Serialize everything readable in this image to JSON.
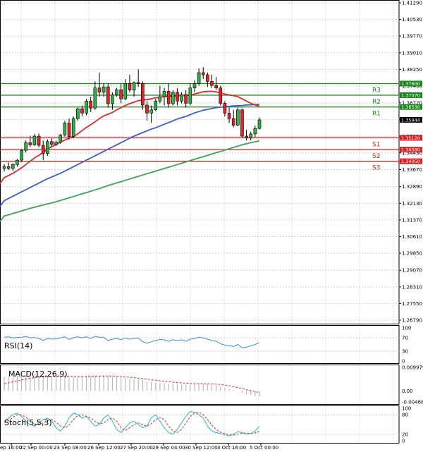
{
  "chart_data": {
    "type": "candlestick",
    "price_axis": {
      "ticks": [
        "1.41290",
        "1.40530",
        "1.39770",
        "1.39010",
        "1.38250",
        "1.37490",
        "1.36720",
        "1.35960",
        "1.35190",
        "1.34430",
        "1.33670",
        "1.32890",
        "1.32130",
        "1.31370",
        "1.30610",
        "1.29850",
        "1.29070",
        "1.28310",
        "1.27550",
        "1.26790"
      ],
      "ylim": [
        1.2679,
        1.4129
      ]
    },
    "x_axis": {
      "ticks": [
        "ep 16:00",
        "22 Sep 00:00",
        "23 Sep 08:00",
        "26 Sep 12:00",
        "27 Sep 20:00",
        "29 Sep 04:00",
        "30 Sep 12:00",
        "3 Oct 16:00",
        "5 Oct 00:00"
      ]
    },
    "levels": [
      {
        "name": "R3",
        "value": 1.376,
        "tag": "1.37600",
        "color": "#1a8a1a"
      },
      {
        "name": "R2",
        "value": 1.3707,
        "tag": "1.37070",
        "color": "#1a8a1a"
      },
      {
        "name": "R1",
        "value": 1.3653,
        "tag": "1.36530",
        "color": "#1a8a1a"
      },
      {
        "name": "S1",
        "value": 1.3512,
        "tag": "1.35120",
        "color": "#e02020"
      },
      {
        "name": "S2",
        "value": 1.3458,
        "tag": "1.34580",
        "color": "#e02020"
      },
      {
        "name": "S3",
        "value": 1.3405,
        "tag": "1.34050",
        "color": "#e02020"
      }
    ],
    "current_price": {
      "value": 1.35944,
      "tag": "1.35944"
    },
    "candles": [
      {
        "o": 1.3372,
        "h": 1.3392,
        "l": 1.3358,
        "c": 1.338
      },
      {
        "o": 1.338,
        "h": 1.34,
        "l": 1.3365,
        "c": 1.3373
      },
      {
        "o": 1.3373,
        "h": 1.3396,
        "l": 1.336,
        "c": 1.339
      },
      {
        "o": 1.339,
        "h": 1.3416,
        "l": 1.338,
        "c": 1.341
      },
      {
        "o": 1.341,
        "h": 1.346,
        "l": 1.3402,
        "c": 1.3455
      },
      {
        "o": 1.3455,
        "h": 1.35,
        "l": 1.3445,
        "c": 1.349
      },
      {
        "o": 1.349,
        "h": 1.3522,
        "l": 1.347,
        "c": 1.348
      },
      {
        "o": 1.348,
        "h": 1.353,
        "l": 1.3475,
        "c": 1.352
      },
      {
        "o": 1.352,
        "h": 1.3532,
        "l": 1.3468,
        "c": 1.3478
      },
      {
        "o": 1.3478,
        "h": 1.35,
        "l": 1.341,
        "c": 1.344
      },
      {
        "o": 1.344,
        "h": 1.3505,
        "l": 1.343,
        "c": 1.3495
      },
      {
        "o": 1.3495,
        "h": 1.351,
        "l": 1.347,
        "c": 1.3482
      },
      {
        "o": 1.3482,
        "h": 1.35,
        "l": 1.3475,
        "c": 1.3492
      },
      {
        "o": 1.3492,
        "h": 1.353,
        "l": 1.3485,
        "c": 1.3525
      },
      {
        "o": 1.3525,
        "h": 1.359,
        "l": 1.3518,
        "c": 1.358
      },
      {
        "o": 1.358,
        "h": 1.36,
        "l": 1.3505,
        "c": 1.3518
      },
      {
        "o": 1.3518,
        "h": 1.361,
        "l": 1.351,
        "c": 1.36
      },
      {
        "o": 1.36,
        "h": 1.365,
        "l": 1.359,
        "c": 1.3645
      },
      {
        "o": 1.3645,
        "h": 1.366,
        "l": 1.361,
        "c": 1.3625
      },
      {
        "o": 1.3625,
        "h": 1.369,
        "l": 1.3615,
        "c": 1.368
      },
      {
        "o": 1.368,
        "h": 1.37,
        "l": 1.363,
        "c": 1.3648
      },
      {
        "o": 1.3648,
        "h": 1.377,
        "l": 1.364,
        "c": 1.374
      },
      {
        "o": 1.374,
        "h": 1.381,
        "l": 1.37,
        "c": 1.372
      },
      {
        "o": 1.372,
        "h": 1.376,
        "l": 1.37,
        "c": 1.3745
      },
      {
        "o": 1.3745,
        "h": 1.376,
        "l": 1.365,
        "c": 1.3668
      },
      {
        "o": 1.3668,
        "h": 1.372,
        "l": 1.364,
        "c": 1.3708
      },
      {
        "o": 1.3708,
        "h": 1.374,
        "l": 1.37,
        "c": 1.3732
      },
      {
        "o": 1.3732,
        "h": 1.376,
        "l": 1.367,
        "c": 1.369
      },
      {
        "o": 1.369,
        "h": 1.378,
        "l": 1.3685,
        "c": 1.376
      },
      {
        "o": 1.376,
        "h": 1.38,
        "l": 1.372,
        "c": 1.373
      },
      {
        "o": 1.373,
        "h": 1.377,
        "l": 1.37,
        "c": 1.3765
      },
      {
        "o": 1.3765,
        "h": 1.3825,
        "l": 1.3745,
        "c": 1.376
      },
      {
        "o": 1.376,
        "h": 1.377,
        "l": 1.364,
        "c": 1.3662
      },
      {
        "o": 1.3662,
        "h": 1.368,
        "l": 1.359,
        "c": 1.3625
      },
      {
        "o": 1.3625,
        "h": 1.366,
        "l": 1.358,
        "c": 1.364
      },
      {
        "o": 1.364,
        "h": 1.369,
        "l": 1.3635,
        "c": 1.368
      },
      {
        "o": 1.368,
        "h": 1.375,
        "l": 1.367,
        "c": 1.37
      },
      {
        "o": 1.37,
        "h": 1.374,
        "l": 1.366,
        "c": 1.3725
      },
      {
        "o": 1.3725,
        "h": 1.376,
        "l": 1.365,
        "c": 1.3668
      },
      {
        "o": 1.3668,
        "h": 1.373,
        "l": 1.366,
        "c": 1.372
      },
      {
        "o": 1.372,
        "h": 1.374,
        "l": 1.366,
        "c": 1.368
      },
      {
        "o": 1.368,
        "h": 1.372,
        "l": 1.367,
        "c": 1.371
      },
      {
        "o": 1.371,
        "h": 1.373,
        "l": 1.365,
        "c": 1.367
      },
      {
        "o": 1.367,
        "h": 1.376,
        "l": 1.366,
        "c": 1.374
      },
      {
        "o": 1.374,
        "h": 1.3775,
        "l": 1.372,
        "c": 1.376
      },
      {
        "o": 1.376,
        "h": 1.383,
        "l": 1.375,
        "c": 1.381
      },
      {
        "o": 1.381,
        "h": 1.3835,
        "l": 1.378,
        "c": 1.38
      },
      {
        "o": 1.38,
        "h": 1.381,
        "l": 1.3745,
        "c": 1.377
      },
      {
        "o": 1.377,
        "h": 1.38,
        "l": 1.374,
        "c": 1.3752
      },
      {
        "o": 1.3752,
        "h": 1.379,
        "l": 1.373,
        "c": 1.374
      },
      {
        "o": 1.374,
        "h": 1.375,
        "l": 1.366,
        "c": 1.367
      },
      {
        "o": 1.367,
        "h": 1.368,
        "l": 1.361,
        "c": 1.3625
      },
      {
        "o": 1.3625,
        "h": 1.365,
        "l": 1.358,
        "c": 1.36
      },
      {
        "o": 1.36,
        "h": 1.364,
        "l": 1.356,
        "c": 1.357
      },
      {
        "o": 1.357,
        "h": 1.365,
        "l": 1.3565,
        "c": 1.364
      },
      {
        "o": 1.364,
        "h": 1.3645,
        "l": 1.351,
        "c": 1.352
      },
      {
        "o": 1.352,
        "h": 1.355,
        "l": 1.35,
        "c": 1.3512
      },
      {
        "o": 1.3512,
        "h": 1.354,
        "l": 1.35,
        "c": 1.353
      },
      {
        "o": 1.353,
        "h": 1.3568,
        "l": 1.3515,
        "c": 1.3555
      },
      {
        "o": 1.3555,
        "h": 1.3605,
        "l": 1.355,
        "c": 1.3594
      }
    ],
    "ma_red": [
      1.333,
      1.334,
      1.335,
      1.3362,
      1.3375,
      1.339,
      1.3405,
      1.342,
      1.3432,
      1.3445,
      1.346,
      1.3472,
      1.3482,
      1.3492,
      1.3502,
      1.351,
      1.3518,
      1.353,
      1.3545,
      1.356,
      1.3572,
      1.3585,
      1.36,
      1.3612,
      1.362,
      1.3628,
      1.364,
      1.365,
      1.366,
      1.3668,
      1.3675,
      1.3682,
      1.3685,
      1.3687,
      1.369,
      1.3695,
      1.3698,
      1.37,
      1.3701,
      1.3702,
      1.3704,
      1.3705,
      1.3706,
      1.3708,
      1.3712,
      1.3718,
      1.3722,
      1.3724,
      1.3725,
      1.3722,
      1.3718,
      1.3712,
      1.3708,
      1.3705,
      1.37,
      1.369,
      1.368,
      1.367,
      1.3662,
      1.3656
    ],
    "ma_blue": [
      1.3225,
      1.3235,
      1.3245,
      1.3255,
      1.3265,
      1.3275,
      1.3285,
      1.3295,
      1.3305,
      1.3315,
      1.3325,
      1.3333,
      1.3342,
      1.335,
      1.336,
      1.337,
      1.338,
      1.339,
      1.34,
      1.341,
      1.342,
      1.343,
      1.344,
      1.345,
      1.346,
      1.347,
      1.348,
      1.349,
      1.35,
      1.351,
      1.352,
      1.3528,
      1.3536,
      1.3544,
      1.3552,
      1.3558,
      1.3566,
      1.3574,
      1.3582,
      1.359,
      1.3598,
      1.3604,
      1.361,
      1.3618,
      1.3626,
      1.3632,
      1.3638,
      1.3642,
      1.3646,
      1.365,
      1.3652,
      1.3654,
      1.3656,
      1.3658,
      1.3659,
      1.366,
      1.3662,
      1.3663,
      1.3664,
      1.3664
    ],
    "ma_green": [
      1.3155,
      1.316,
      1.3166,
      1.3172,
      1.3178,
      1.3184,
      1.319,
      1.3195,
      1.32,
      1.3205,
      1.321,
      1.3215,
      1.322,
      1.3226,
      1.3232,
      1.3238,
      1.3244,
      1.325,
      1.3256,
      1.3262,
      1.3268,
      1.3274,
      1.328,
      1.3287,
      1.3294,
      1.33,
      1.3306,
      1.3312,
      1.3318,
      1.3324,
      1.333,
      1.3336,
      1.3342,
      1.3348,
      1.3354,
      1.336,
      1.3366,
      1.3372,
      1.3378,
      1.3384,
      1.339,
      1.3396,
      1.3402,
      1.3408,
      1.3414,
      1.342,
      1.3426,
      1.3432,
      1.3438,
      1.3444,
      1.345,
      1.3456,
      1.3462,
      1.3468,
      1.3474,
      1.348,
      1.3485,
      1.349,
      1.3494,
      1.3498
    ],
    "rsi": {
      "label": "RSI(14)",
      "ticks": [
        "100",
        "70",
        "30",
        "0"
      ],
      "values": [
        72,
        73,
        70,
        71,
        72,
        74,
        70,
        71,
        68,
        62,
        68,
        66,
        67,
        70,
        73,
        65,
        70,
        73,
        70,
        73,
        68,
        74,
        72,
        72,
        62,
        66,
        68,
        64,
        70,
        66,
        68,
        70,
        58,
        54,
        58,
        62,
        65,
        64,
        60,
        64,
        62,
        64,
        60,
        66,
        68,
        72,
        70,
        66,
        62,
        60,
        52,
        48,
        46,
        44,
        50,
        40,
        42,
        46,
        50,
        56
      ]
    },
    "macd": {
      "label": "MACD(12,26,9)",
      "ticks": [
        "0.009979",
        "0.00",
        "-0.004686"
      ],
      "hist": [
        0.006,
        0.0061,
        0.0062,
        0.0063,
        0.0065,
        0.0066,
        0.0066,
        0.0066,
        0.0065,
        0.0064,
        0.0063,
        0.0062,
        0.0061,
        0.006,
        0.006,
        0.0059,
        0.0058,
        0.0059,
        0.006,
        0.0061,
        0.0062,
        0.0063,
        0.0064,
        0.0065,
        0.0063,
        0.0061,
        0.0059,
        0.0056,
        0.0054,
        0.0051,
        0.005,
        0.0049,
        0.0045,
        0.004,
        0.0037,
        0.0035,
        0.0034,
        0.0033,
        0.0031,
        0.003,
        0.0029,
        0.0028,
        0.0027,
        0.0027,
        0.0028,
        0.003,
        0.003,
        0.0029,
        0.0027,
        0.0024,
        0.0019,
        0.0013,
        0.0008,
        0.0003,
        0.0,
        -0.0008,
        -0.0014,
        -0.0018,
        -0.0022,
        -0.0024
      ],
      "signal": [
        0.003,
        0.0034,
        0.0038,
        0.0042,
        0.0046,
        0.005,
        0.0053,
        0.0056,
        0.0058,
        0.006,
        0.0061,
        0.0062,
        0.0062,
        0.0062,
        0.0062,
        0.0062,
        0.0061,
        0.0061,
        0.0061,
        0.0061,
        0.0062,
        0.0062,
        0.0063,
        0.0063,
        0.0063,
        0.0063,
        0.0062,
        0.0061,
        0.0059,
        0.0058,
        0.0056,
        0.0054,
        0.0052,
        0.005,
        0.0047,
        0.0045,
        0.0043,
        0.0041,
        0.0039,
        0.0037,
        0.0035,
        0.0034,
        0.0033,
        0.0032,
        0.0031,
        0.0031,
        0.0031,
        0.003,
        0.003,
        0.0029,
        0.0027,
        0.0025,
        0.0022,
        0.0018,
        0.0014,
        0.001,
        0.0005,
        0.0001,
        -0.0003,
        -0.0008
      ]
    },
    "stoch": {
      "label": "Stoch(5,5,3)",
      "ticks": [
        "100",
        "80",
        "20",
        "0"
      ],
      "k": [
        60,
        70,
        80,
        85,
        75,
        60,
        50,
        45,
        55,
        65,
        70,
        60,
        40,
        30,
        45,
        70,
        85,
        80,
        70,
        75,
        60,
        45,
        50,
        70,
        80,
        60,
        35,
        25,
        40,
        55,
        60,
        50,
        40,
        45,
        70,
        80,
        60,
        40,
        25,
        20,
        35,
        55,
        75,
        90,
        88,
        80,
        70,
        45,
        30,
        25,
        22,
        18,
        15,
        20,
        28,
        25,
        20,
        22,
        30,
        45
      ],
      "d": [
        55,
        62,
        72,
        80,
        80,
        72,
        62,
        52,
        50,
        55,
        63,
        65,
        57,
        45,
        40,
        48,
        65,
        78,
        80,
        75,
        70,
        60,
        52,
        55,
        65,
        70,
        60,
        40,
        32,
        40,
        50,
        55,
        50,
        45,
        52,
        65,
        72,
        65,
        45,
        30,
        25,
        35,
        55,
        75,
        85,
        88,
        80,
        65,
        48,
        35,
        26,
        22,
        18,
        17,
        20,
        23,
        24,
        22,
        24,
        30
      ]
    }
  }
}
